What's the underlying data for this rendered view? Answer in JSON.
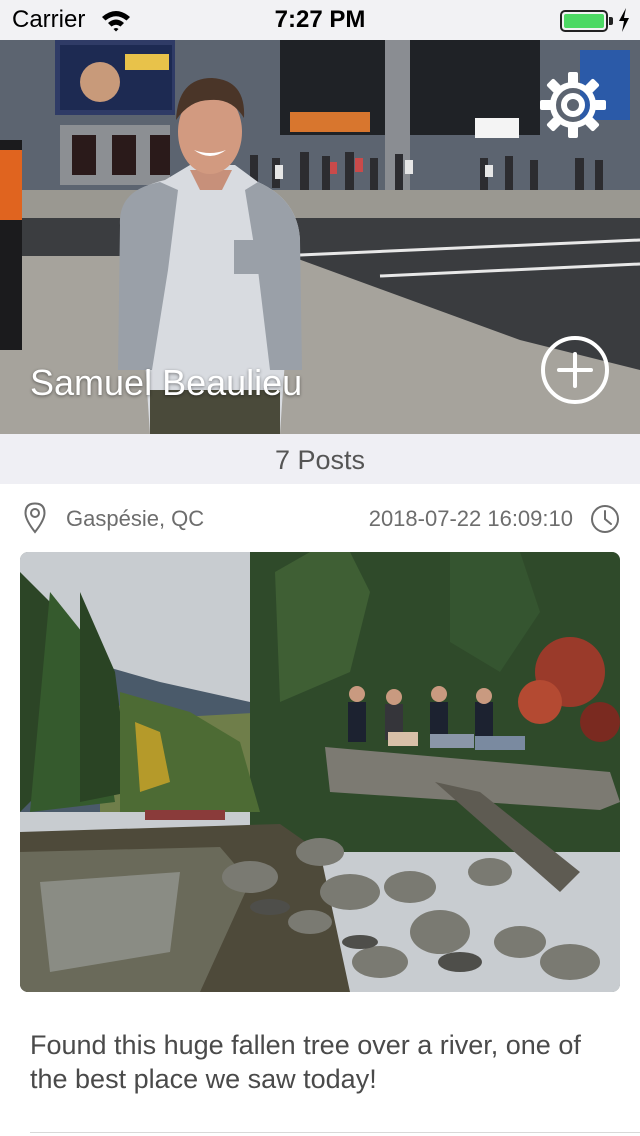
{
  "status_bar": {
    "carrier": "Carrier",
    "time": "7:27 PM",
    "battery_color": "#4cd964"
  },
  "profile": {
    "name": "Samuel Beaulieu",
    "settings_icon": "gear-icon",
    "add_icon": "plus-circle-icon"
  },
  "posts_count_label": "7 Posts",
  "post": {
    "location": "Gaspésie, QC",
    "datetime": "2018-07-22 16:09:10",
    "caption": "Found this huge fallen tree over a river, one of the best place we saw today!",
    "location_icon": "map-pin-icon",
    "time_icon": "clock-icon"
  }
}
